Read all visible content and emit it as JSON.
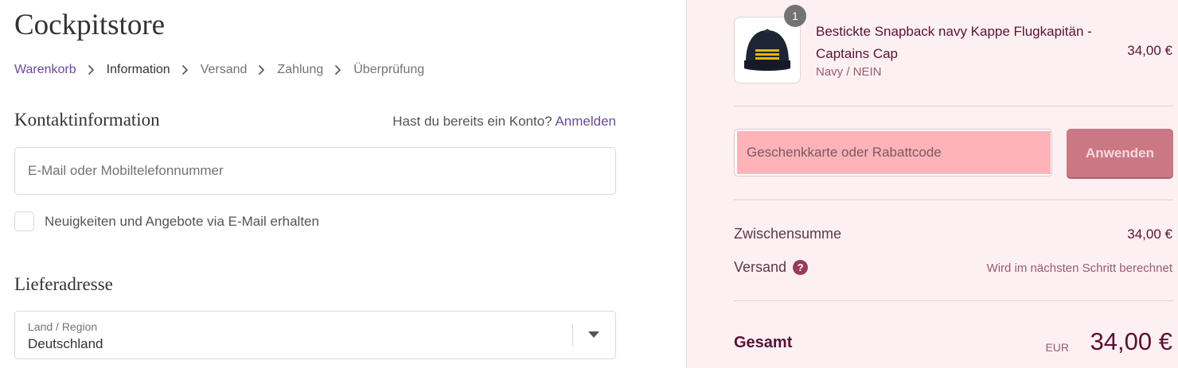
{
  "store": {
    "title": "Cockpitstore"
  },
  "breadcrumb": {
    "items": [
      "Warenkorb",
      "Information",
      "Versand",
      "Zahlung",
      "Überprüfung"
    ]
  },
  "contact": {
    "heading": "Kontaktinformation",
    "login_prompt": "Hast du bereits ein Konto?",
    "login_link": "Anmelden",
    "email_placeholder": "E-Mail oder Mobiltelefonnummer",
    "newsletter_label": "Neuigkeiten und Angebote via E-Mail erhalten",
    "newsletter_checked": false
  },
  "address": {
    "heading": "Lieferadresse",
    "country_label": "Land / Region",
    "country_value": "Deutschland"
  },
  "order": {
    "product": {
      "name": "Bestickte Snapback navy Kappe Flugkapitän - Captains Cap",
      "variant": "Navy / NEIN",
      "price": "34,00 €",
      "quantity": "1"
    },
    "discount": {
      "placeholder": "Geschenkkarte oder Rabattcode",
      "apply_label": "Anwenden"
    },
    "subtotal_label": "Zwischensumme",
    "subtotal_value": "34,00 €",
    "shipping_label": "Versand",
    "shipping_value": "Wird im nächsten Schritt berechnet",
    "total_label": "Gesamt",
    "total_currency": "EUR",
    "total_value": "34,00 €"
  },
  "colors": {
    "accent": "#6b4a9a",
    "sidebar_bg": "#fdf0f2",
    "apply_button": "#cb7885",
    "discount_highlight": "#fdb3b8",
    "price_text": "#5a1234"
  },
  "icons": {
    "breadcrumb_separator": "chevron-right-icon",
    "select_arrow": "caret-down-icon",
    "help": "question-circle-icon"
  }
}
